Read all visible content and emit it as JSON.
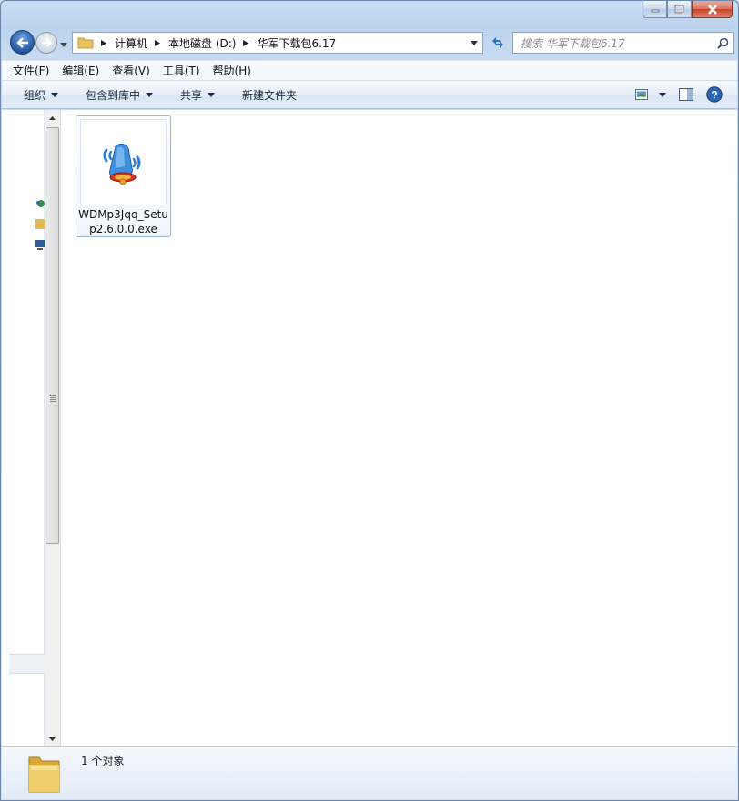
{
  "window": {
    "caption_buttons": [
      "minimize-icon",
      "maximize-icon",
      "close-icon"
    ]
  },
  "address_bar": {
    "breadcrumbs": [
      "计算机",
      "本地磁盘 (D:)",
      "华军下载包6.17"
    ]
  },
  "search": {
    "placeholder": "搜索 华军下载包6.17"
  },
  "menu": {
    "items": [
      "文件(F)",
      "编辑(E)",
      "查看(V)",
      "工具(T)",
      "帮助(H)"
    ]
  },
  "toolbar": {
    "organize": "组织",
    "include_in_library": "包含到库中",
    "share": "共享",
    "new_folder": "新建文件夹",
    "right_icons": [
      "view-options-icon",
      "preview-pane-icon",
      "help-icon"
    ]
  },
  "files": [
    {
      "name": "WDMp3Jqq_Setup2.6.0.0.exe",
      "icon": "bell-speaker-icon"
    }
  ],
  "status": {
    "count_text": "1 个对象"
  },
  "colors": {
    "frame": "#c6daf1",
    "content_bg": "#ffffff",
    "selection_border": "#9ab6d8",
    "close_button": "#c7442a"
  }
}
